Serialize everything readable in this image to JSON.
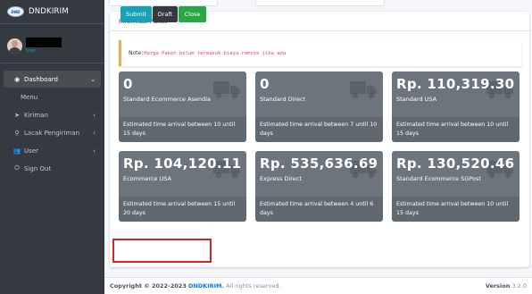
{
  "brand": {
    "name": "DNDKIRIM",
    "logo_text": "DND"
  },
  "user": {
    "role": "User"
  },
  "sidebar": {
    "items": [
      {
        "label": "Dashboard",
        "icon": "tachometer-icon",
        "glyph": "◉",
        "arrow": "⌄",
        "active": true
      },
      {
        "label": "Menu"
      },
      {
        "label": "Kiriman",
        "icon": "paper-plane-icon",
        "glyph": "➤",
        "arrow": "‹"
      },
      {
        "label": "Lacak Pengiriman",
        "icon": "search-icon",
        "glyph": "⚲",
        "arrow": "‹"
      },
      {
        "label": "User",
        "icon": "users-icon",
        "glyph": "👥",
        "arrow": "‹"
      },
      {
        "label": "Sign Out",
        "icon": "power-icon",
        "glyph": "⏻"
      }
    ]
  },
  "card": {
    "title": "Informasi Paket",
    "note_label": "Note:",
    "note_text": "Harga Paket belum termasuk biaya remote jika ada"
  },
  "boxes": [
    {
      "value": "0",
      "name": "Standard Ecommerce Asendia",
      "eta": "Estimated time arrival between 10 until 15 days"
    },
    {
      "value": "0",
      "name": "Standard Direct",
      "eta": "Estimated time arrival between 7 until 10 days"
    },
    {
      "value": "Rp. 110,319.30",
      "name": "Standard USA",
      "eta": "Estimated time arrival between 10 until 15 days"
    },
    {
      "value": "Rp. 104,120.11",
      "name": "Ecommerce USA",
      "eta": "Estimated time arrival between 15 until 20 days"
    },
    {
      "value": "Rp. 535,636.69",
      "name": "Express Direct",
      "eta": "Estimated time arrival between 4 until 6 days"
    },
    {
      "value": "Rp. 130,520.46",
      "name": "Standard Ecommerce SGPost",
      "eta": "Estimated time arrival between 10 until 15 days"
    }
  ],
  "buttons": {
    "submit": "Submit",
    "draft": "Draft",
    "close": "Close"
  },
  "footer": {
    "copyright": "Copyright © 2022-2023",
    "brand": "DNDKIRIM.",
    "rights": "All rights reserved.",
    "version_label": "Version",
    "version": "3.2.0"
  },
  "colors": {
    "sidebar": "#343a40",
    "box": "#6c757d",
    "submit": "#17a2b8",
    "draft": "#343a40",
    "close": "#28a745",
    "highlight": "#e02020",
    "note": "#e83e8c"
  }
}
